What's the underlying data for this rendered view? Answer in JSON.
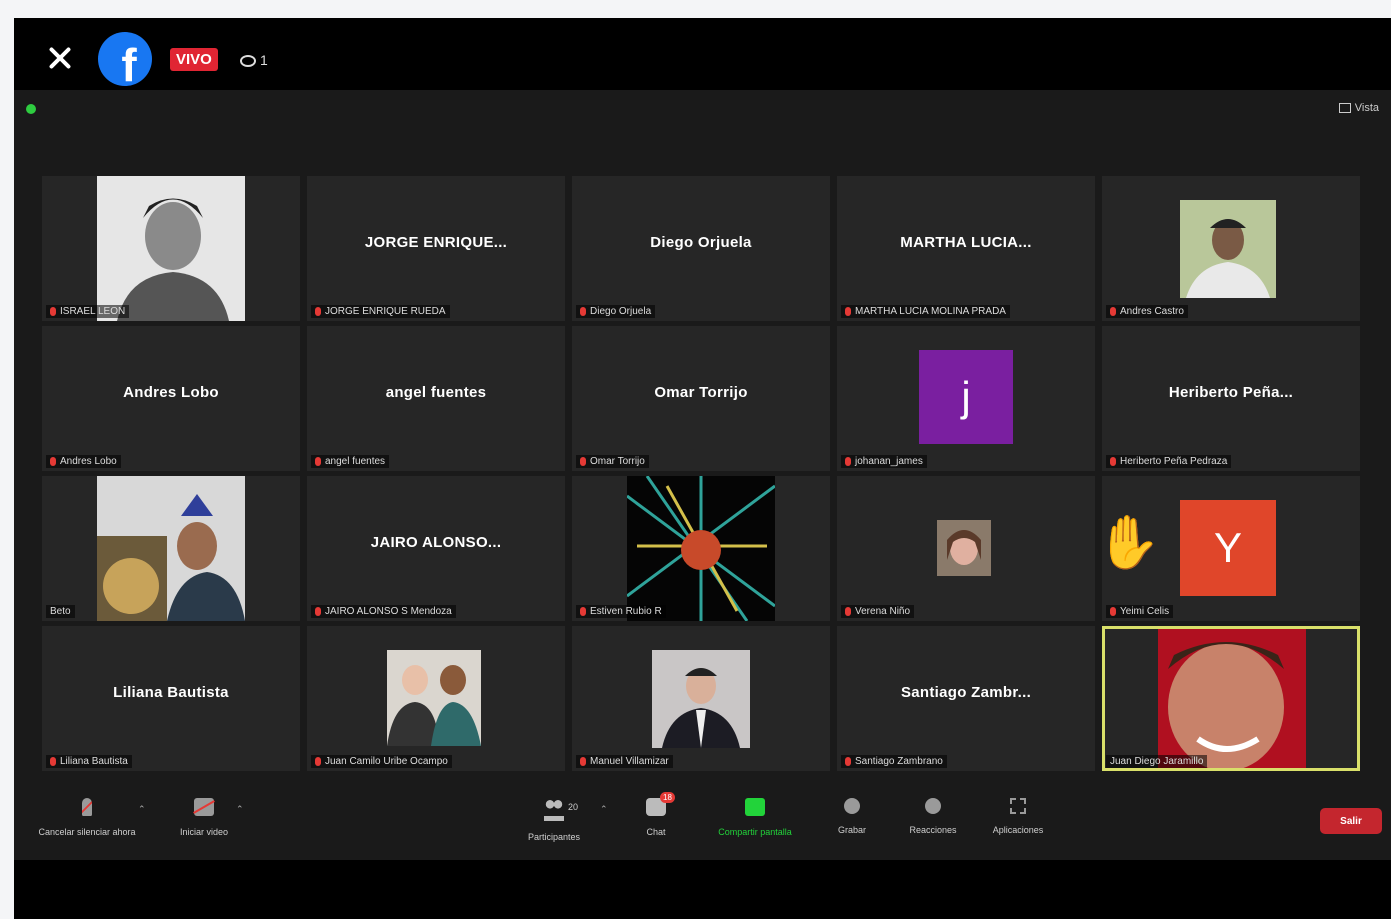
{
  "facebook": {
    "live_label": "VIVO",
    "viewer_count": "1"
  },
  "zoom": {
    "view_label": "Vista",
    "colors": {
      "accent_green": "#22d33a",
      "mic_off_red": "#e53935",
      "leave_red": "#c4262e",
      "active_border": "#d9e06a"
    },
    "tiles": [
      {
        "center": "",
        "label": "ISRAEL LEON",
        "muted": true
      },
      {
        "center": "JORGE ENRIQUE...",
        "label": "JORGE ENRIQUE RUEDA",
        "muted": true
      },
      {
        "center": "Diego Orjuela",
        "label": "Diego Orjuela",
        "muted": true
      },
      {
        "center": "MARTHA LUCIA...",
        "label": "MARTHA LUCIA MOLINA PRADA",
        "muted": true
      },
      {
        "center": "",
        "label": "Andres Castro",
        "muted": true
      },
      {
        "center": "Andres Lobo",
        "label": "Andres Lobo",
        "muted": true
      },
      {
        "center": "angel fuentes",
        "label": "angel fuentes",
        "muted": true
      },
      {
        "center": "Omar Torrijo",
        "label": "Omar Torrijo",
        "muted": true
      },
      {
        "center": "",
        "label": "johanan_james",
        "muted": true,
        "avatar": "j"
      },
      {
        "center": "Heriberto Peña...",
        "label": "Heriberto Peña Pedraza",
        "muted": true
      },
      {
        "center": "",
        "label": "Beto",
        "muted": false
      },
      {
        "center": "JAIRO ALONSO...",
        "label": "JAIRO ALONSO S Mendoza",
        "muted": true
      },
      {
        "center": "",
        "label": "Estiven Rubio R",
        "muted": true
      },
      {
        "center": "",
        "label": "Verena Niño",
        "muted": true
      },
      {
        "center": "",
        "label": "Yeimi Celis",
        "muted": true,
        "avatar": "Y"
      },
      {
        "center": "Liliana Bautista",
        "label": "Liliana Bautista",
        "muted": true
      },
      {
        "center": "",
        "label": "Juan Camilo Uribe Ocampo",
        "muted": true
      },
      {
        "center": "",
        "label": "Manuel Villamizar",
        "muted": true
      },
      {
        "center": "Santiago Zambr...",
        "label": "Santiago Zambrano",
        "muted": true
      },
      {
        "center": "",
        "label": "Juan Diego Jaramillo",
        "muted": false
      }
    ],
    "toolbar": {
      "mute": "Cancelar silenciar ahora",
      "video": "Iniciar video",
      "participants": "Participantes",
      "participants_count": "20",
      "chat": "Chat",
      "chat_badge": "18",
      "share": "Compartir pantalla",
      "record": "Grabar",
      "reactions": "Reacciones",
      "apps": "Aplicaciones",
      "leave": "Salir"
    }
  }
}
